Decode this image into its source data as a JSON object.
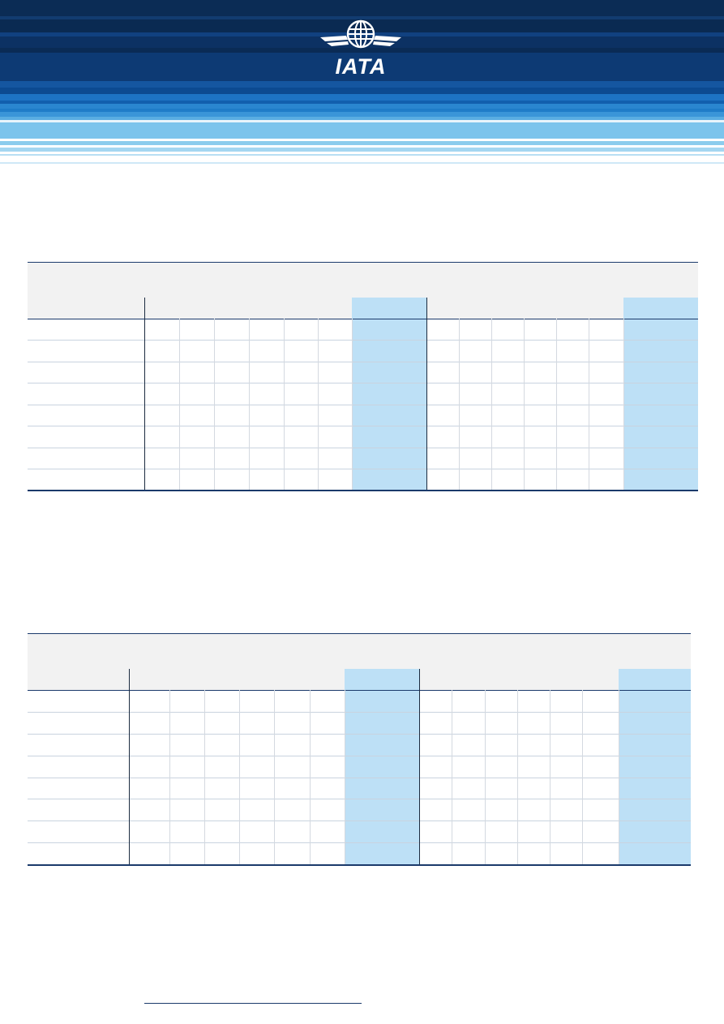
{
  "brand": {
    "logo_text": "IATA",
    "colors": {
      "navy": "#0f3460",
      "mid_blue": "#1a6fb8",
      "light_blue": "#7cc4ec",
      "table_highlight": "#bde0f6",
      "rule": "#1b3a6b"
    },
    "icons": [
      "globe-icon",
      "wings-icon"
    ]
  },
  "tables": [
    {
      "rows": 8,
      "left_group_cols": 6,
      "right_group_cols": 6
    },
    {
      "rows": 8,
      "left_group_cols": 6,
      "right_group_cols": 6
    }
  ]
}
